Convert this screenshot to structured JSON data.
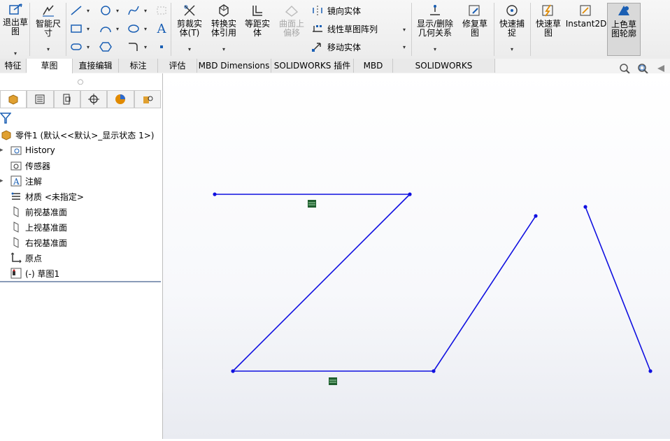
{
  "ribbon": {
    "exit_sketch": "退出草图",
    "smart_dimension": "智能尺寸",
    "trim_entities": "剪裁实体(T)",
    "convert_entities": "转换实体引用",
    "offset_entities": "等距实体",
    "surface_offset": "曲面上偏移",
    "mirror_entities": "镜向实体",
    "linear_pattern": "线性草图阵列",
    "move_entities": "移动实体",
    "display_delete_relations": "显示/删除几何关系",
    "repair_sketch": "修复草图",
    "quick_snaps": "快速捕捉",
    "rapid_sketch": "快速草图",
    "instant2d": "Instant2D",
    "shaded_contours": "上色草图轮廓"
  },
  "tabs": [
    "特征",
    "草图",
    "直接编辑",
    "标注",
    "评估",
    "MBD Dimensions",
    "SOLIDWORKS 插件",
    "MBD",
    "SOLIDWORKS Inspection"
  ],
  "selected_tab": "草图",
  "tree": {
    "root": "零件1  (默认<<默认>_显示状态 1>)",
    "items": [
      "History",
      "传感器",
      "注解",
      "材质 <未指定>",
      "前视基准面",
      "上视基准面",
      "右视基准面",
      "原点",
      "(-) 草图1"
    ]
  },
  "colors": {
    "sketch_line": "#1010e0",
    "relation_badge": "#1e5e2e",
    "accent_blue": "#1a5fb4"
  }
}
